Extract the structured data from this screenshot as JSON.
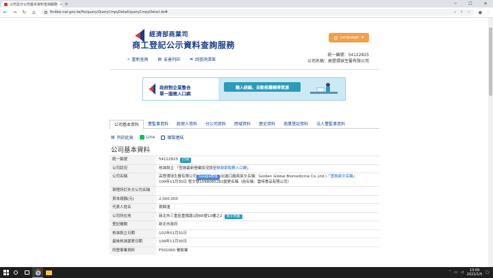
{
  "browser": {
    "tab_title": "公司及分公司基本資料查詢服務",
    "url": "findbiz.nat.gov.tw/fts/query/QueryCmpyDetail/queryCmpyDetail.do#"
  },
  "header": {
    "ministry": "經濟部商業司",
    "service": "商工登記公示資料查詢服務",
    "language_button": "Language",
    "nav": [
      {
        "label": "重新查詢"
      },
      {
        "label": "友善列印"
      },
      {
        "label": "回查詢清單"
      }
    ],
    "company_id_line": "統一編號：54122825",
    "company_name_line": "公司名稱：高登環球生醫有限公司"
  },
  "banner": {
    "line1": "政府對企業整合",
    "line2": "單一服務入口網",
    "pill": "輸入統編，自動推薦輔導資源"
  },
  "tabs": [
    {
      "label": "公司基本資料"
    },
    {
      "label": "董監事資料"
    },
    {
      "label": "經理人資料"
    },
    {
      "label": "分公司資料"
    },
    {
      "label": "跨域資料"
    },
    {
      "label": "歷史資料"
    },
    {
      "label": "商業登記資料"
    },
    {
      "label": "法人董監事資料"
    }
  ],
  "tools": {
    "print": "列印此頁",
    "line": "Line",
    "copy": "複製連結"
  },
  "section_title": "公司基本資料",
  "rows": {
    "id_key": "統一編號",
    "id_value": "54122825",
    "id_badge": "訂閱",
    "status_key": "公司狀況",
    "status_value": "核准設立 「查詢最新營業狀況請至",
    "status_link": "財政部稅務入口網",
    "status_end": "」",
    "name_key": "公司名稱",
    "name_value": "高登環球生醫有限公司",
    "name_google": "Google搜尋",
    "name_en": "(出進口廠商英文名稱：Golden Global Biomedicine Co.,Ltd.)",
    "name_link": "「查詢英文名稱」",
    "name_change": "109年11月30日 發文號1098085282變更名稱（前名稱：雲峙食品有限公司）",
    "foreign_key": "章程所訂外文公司名稱",
    "capital_key": "資本總額(元)",
    "capital_value": "2,000,000",
    "rep_key": "代表人姓名",
    "rep_value": "劉韓潼",
    "addr_key": "公司所在地",
    "addr_value": "新北市三重區重陽路1段66號10樓之2",
    "addr_badge": "電子地圖",
    "org_key": "登記機關",
    "org_value": "新北市政府",
    "setup_key": "核准設立日期",
    "setup_value": "102年01月31日",
    "change_key": "最後核准變更日期",
    "change_value": "109年11月30日",
    "biz_key": "所營事業資料",
    "biz_value": "F501060 餐飲業"
  },
  "taskbar": {
    "time": "13:09",
    "date": "2022/1/5"
  },
  "colors": {
    "brand": "#1a3e8a",
    "accent": "#f0a14a",
    "badge": "#2a9cb8"
  }
}
